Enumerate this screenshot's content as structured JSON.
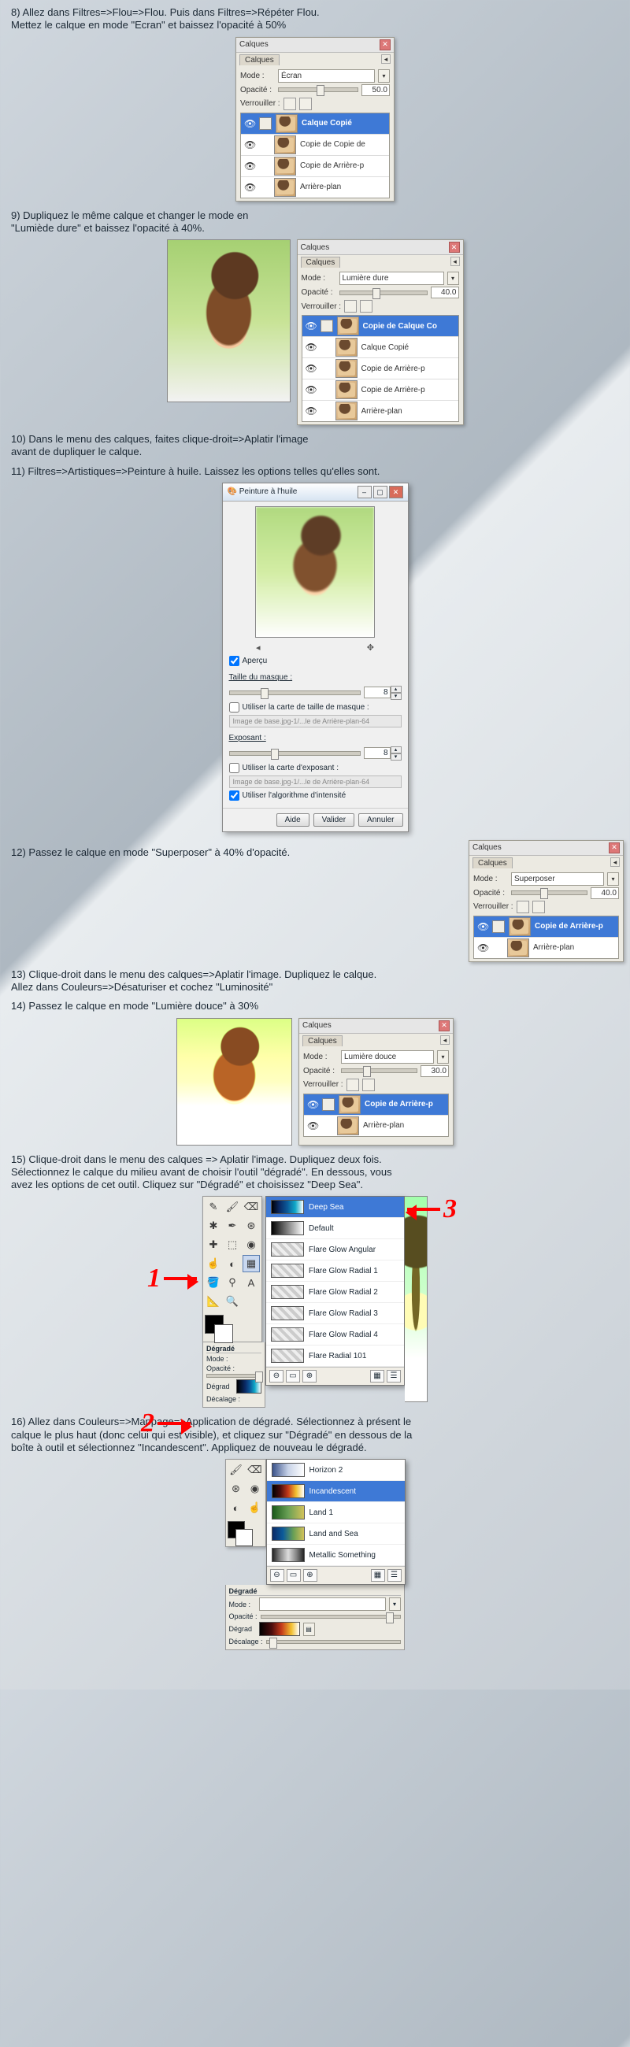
{
  "steps": {
    "s8": "8) Allez dans Filtres=>Flou=>Flou. Puis dans Filtres=>Répéter Flou.\nMettez le calque en mode \"Ecran\" et baissez l'opacité à 50%",
    "s9": "9) Dupliquez le même calque et changer le mode en\n\"Lumiède dure\" et baissez l'opacité à 40%.",
    "s10": "10) Dans le menu des calques, faites clique-droit=>Aplatir l'image\n avant de dupliquer le calque.",
    "s11": "11) Filtres=>Artistiques=>Peinture à huile. Laissez les options telles qu'elles sont.",
    "s12": "12) Passez le calque en mode \"Superposer\" à 40% d'opacité.",
    "s13": "13) Clique-droit dans le menu des calques=>Aplatir l'image. Dupliquez le calque.\n Allez dans Couleurs=>Désaturiser et cochez \"Luminosité\"",
    "s14": "14) Passez le calque en mode \"Lumière douce\" à 30%",
    "s15": "15) Clique-droit dans le menu des calques => Aplatir l'image. Dupliquez deux fois.\nSélectionnez le calque du milieu avant de choisir l'outil \"dégradé\". En dessous, vous\navez les options de cet outil. Cliquez sur \"Dégradé\" et choisissez \"Deep Sea\".",
    "s16": "16) Allez dans Couleurs=>Mappage=>Application de dégradé. Sélectionnez à présent le\ncalque le plus haut (donc celui qui est visible), et cliquez sur \"Dégradé\" en dessous de la\nboîte à outil et sélectionnez \"Incandescent\". Appliquez de nouveau le dégradé."
  },
  "labels": {
    "calques": "Calques",
    "mode": "Mode :",
    "opacite": "Opacité :",
    "verrouiller": "Verrouiller :",
    "degrade_h": "Dégradé",
    "degrade": "Dégrad",
    "decalage": "Décalage :"
  },
  "panel8": {
    "mode": "Écran",
    "opacity": "50.0",
    "layers": [
      "Calque Copié",
      "Copie de Copie de",
      "Copie de Arrière-p",
      "Arrière-plan"
    ]
  },
  "panel9": {
    "mode": "Lumière dure",
    "opacity": "40.0",
    "layers": [
      "Copie de Calque Co",
      "Calque Copié",
      "Copie de Arrière-p",
      "Copie de Arrière-p",
      "Arrière-plan"
    ]
  },
  "panel12": {
    "mode": "Superposer",
    "opacity": "40.0",
    "layers": [
      "Copie de Arrière-p",
      "Arrière-plan"
    ]
  },
  "panel14": {
    "mode": "Lumière douce",
    "opacity": "30.0",
    "layers": [
      "Copie de Arrière-p",
      "Arrière-plan"
    ]
  },
  "oil": {
    "title": "Peinture à l'huile",
    "apercu": "Aperçu",
    "taille": "Taille du masque :",
    "taille_val": "8",
    "use_size_map": "Utiliser la carte de taille de masque :",
    "map1": "Image de base.jpg-1/...le de Arrière-plan-64",
    "exposant": "Exposant :",
    "exposant_val": "8",
    "use_exp_map": "Utiliser la carte d'exposant :",
    "map2": "Image de base.jpg-1/...le de Arrière-plan-64",
    "use_intensity": "Utiliser l'algorithme d'intensité",
    "btn_help": "Aide",
    "btn_ok": "Valider",
    "btn_cancel": "Annuler"
  },
  "gradients15": [
    "Deep Sea",
    "Default",
    "Flare Glow Angular",
    "Flare Glow Radial 1",
    "Flare Glow Radial 2",
    "Flare Glow Radial 3",
    "Flare Glow Radial 4",
    "Flare Radial 101"
  ],
  "gradients16": [
    "Horizon 2",
    "Incandescent",
    "Land 1",
    "Land and Sea",
    "Metallic Something"
  ],
  "anno": {
    "one": "1",
    "two": "2",
    "three": "3"
  }
}
